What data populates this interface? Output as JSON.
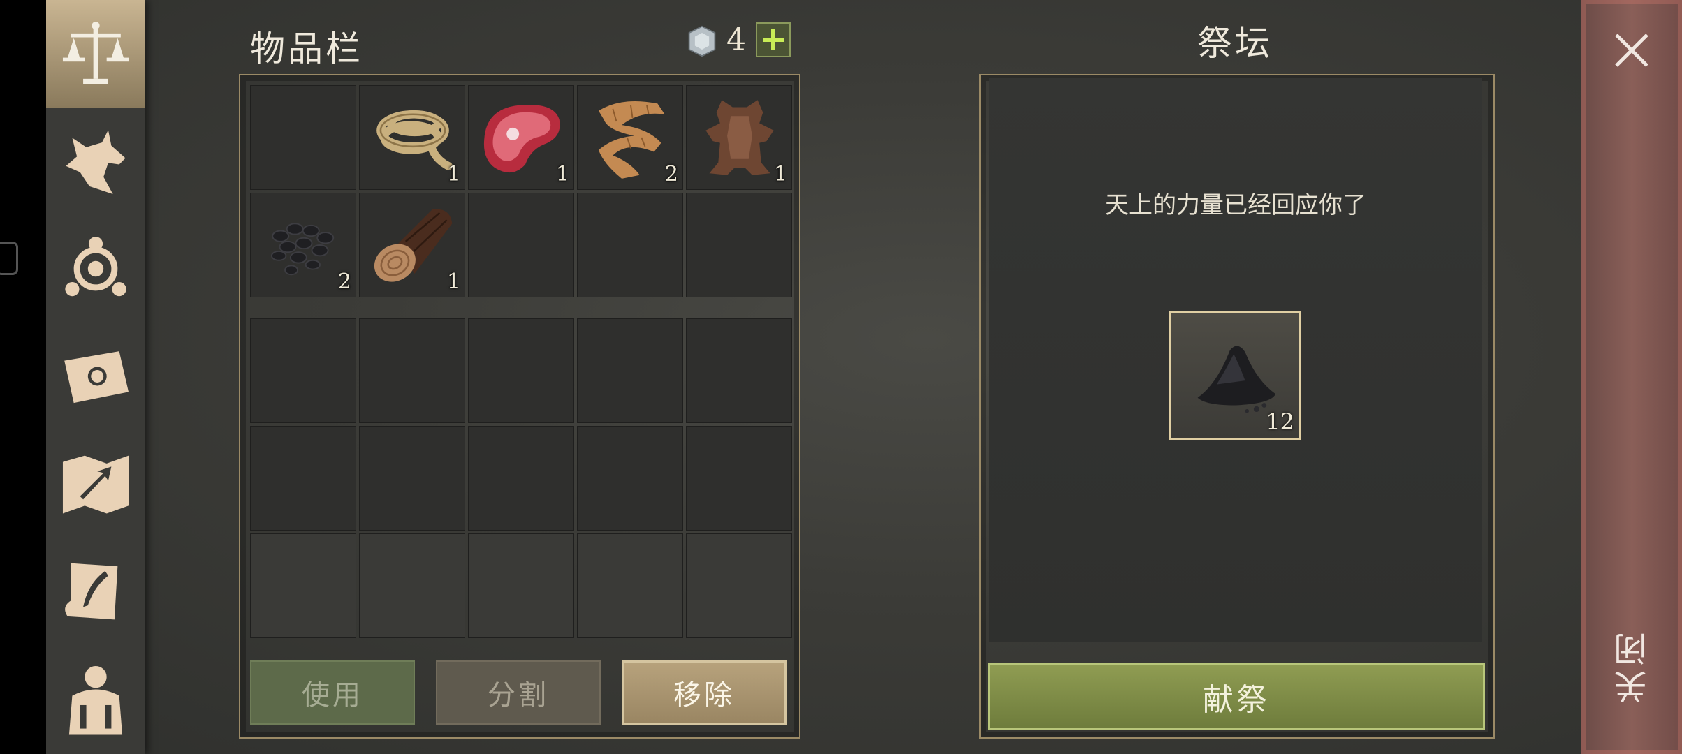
{
  "inventory": {
    "title": "物品栏",
    "currency_count": "4",
    "slots": [
      {
        "item": "",
        "qty": ""
      },
      {
        "item": "rope",
        "qty": "1"
      },
      {
        "item": "raw-meat",
        "qty": "1"
      },
      {
        "item": "fiber",
        "qty": "2"
      },
      {
        "item": "hide",
        "qty": "1"
      },
      {
        "item": "coal",
        "qty": "2"
      },
      {
        "item": "log",
        "qty": "1"
      },
      {
        "item": "",
        "qty": ""
      },
      {
        "item": "",
        "qty": ""
      },
      {
        "item": "",
        "qty": ""
      }
    ],
    "buttons": {
      "use": "使用",
      "split": "分割",
      "remove": "移除"
    }
  },
  "altar": {
    "title": "祭坛",
    "message": "天上的力量已经回应你了",
    "slot": {
      "item": "ash-pile",
      "qty": "12"
    },
    "offer_button": "献祭"
  },
  "close_label": "关闭",
  "colors": {
    "accent_green": "#8f9c52",
    "accent_tan": "#b7a27c",
    "close_red": "#8a5f58"
  }
}
